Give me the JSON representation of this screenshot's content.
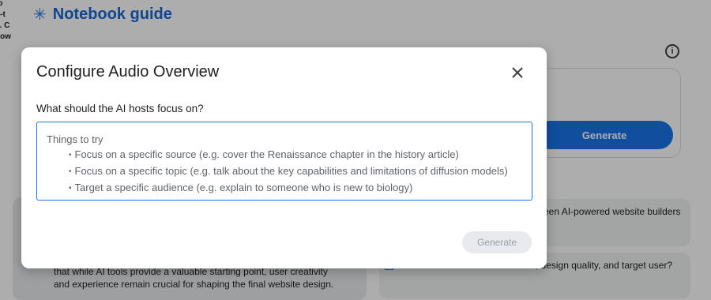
{
  "background": {
    "left_fragments": [
      "to",
      "o-t",
      "s. C",
      "how"
    ],
    "guide_title": "Notebook guide",
    "generate_label": "Generate",
    "card_a_text": "een AI-powered website builders",
    "card_b_text": "reviewed differ in their features, design quality, and target user?",
    "card_c_text": "that while AI tools provide a valuable starting point, user creativity and experience remain crucial for shaping the final website design."
  },
  "modal": {
    "title": "Configure Audio Overview",
    "question": "What should the AI hosts focus on?",
    "tips_title": "Things to try",
    "tips": [
      "Focus on a specific source (e.g. cover the Renaissance chapter in the history article)",
      "Focus on a specific topic (e.g. talk about the key capabilities and limitations of diffusion models)",
      "Target a specific audience (e.g. explain to someone who is new to biology)"
    ],
    "generate_label": "Generate"
  },
  "colors": {
    "accent": "#1a73e8",
    "overlay": "rgba(0,0,0,0.32)",
    "disabled_button": "#e8eaed"
  },
  "icons": {
    "guide_star": "sparkle-icon",
    "info": "info-icon",
    "close": "close-icon",
    "chat": "chat-icon"
  }
}
